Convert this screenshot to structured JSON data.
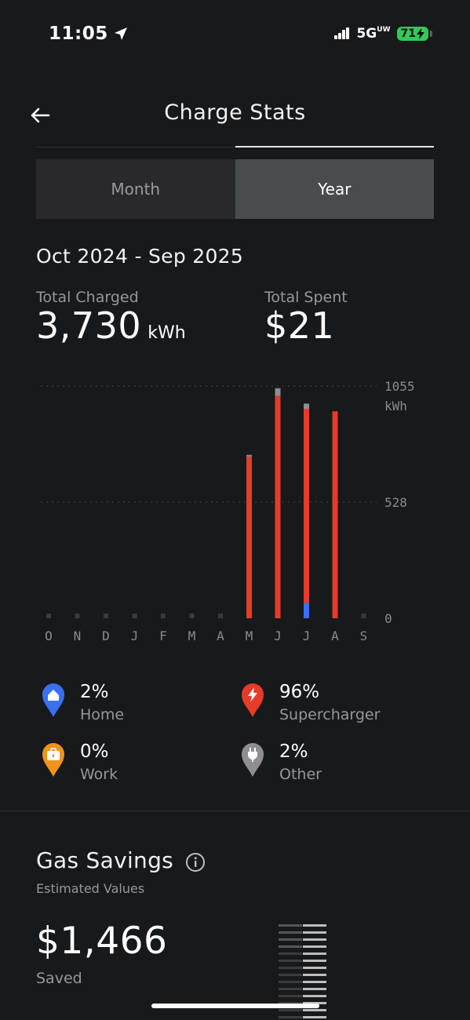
{
  "status_bar": {
    "time": "11:05",
    "network": "5G",
    "network_sup": "UW",
    "battery": "71"
  },
  "header": {
    "title": "Charge Stats"
  },
  "tabs": {
    "month": "Month",
    "year": "Year",
    "active": "year"
  },
  "summary": {
    "period": "Oct 2024 - Sep 2025",
    "total_charged_label": "Total Charged",
    "total_charged_value": "3,730",
    "total_charged_unit": "kWh",
    "total_spent_label": "Total Spent",
    "total_spent_value": "$21"
  },
  "chart_data": {
    "type": "bar",
    "stacked": true,
    "categories": [
      "O",
      "N",
      "D",
      "J",
      "F",
      "M",
      "A",
      "M",
      "J",
      "J",
      "A",
      "S"
    ],
    "series": [
      {
        "name": "Home",
        "color": "#3a6ff0",
        "values": [
          0,
          0,
          0,
          0,
          0,
          0,
          0,
          0,
          0,
          70,
          0,
          0
        ]
      },
      {
        "name": "Supercharger",
        "color": "#e63b27",
        "values": [
          0,
          0,
          0,
          0,
          0,
          0,
          0,
          735,
          1010,
          880,
          940,
          0
        ]
      },
      {
        "name": "Work",
        "color": "#f2931a",
        "values": [
          0,
          0,
          0,
          0,
          0,
          0,
          0,
          0,
          0,
          0,
          0,
          0
        ]
      },
      {
        "name": "Other",
        "color": "#8e8e90",
        "values": [
          0,
          0,
          0,
          0,
          0,
          0,
          0,
          5,
          35,
          25,
          0,
          0
        ]
      }
    ],
    "y_ticks": [
      "1055",
      "528",
      "0"
    ],
    "y_unit": "kWh",
    "ylim": [
      0,
      1055
    ],
    "grid": true
  },
  "legend": [
    {
      "pct": "2%",
      "name": "Home",
      "icon": "home-icon",
      "color": "#3a6ff0"
    },
    {
      "pct": "96%",
      "name": "Supercharger",
      "icon": "lightning-icon",
      "color": "#e63b27"
    },
    {
      "pct": "0%",
      "name": "Work",
      "icon": "briefcase-icon",
      "color": "#f2931a"
    },
    {
      "pct": "2%",
      "name": "Other",
      "icon": "plug-icon",
      "color": "#8e8e90"
    }
  ],
  "gas_savings": {
    "title": "Gas Savings",
    "subtitle": "Estimated Values",
    "value": "$1,466",
    "saved_label": "Saved"
  }
}
